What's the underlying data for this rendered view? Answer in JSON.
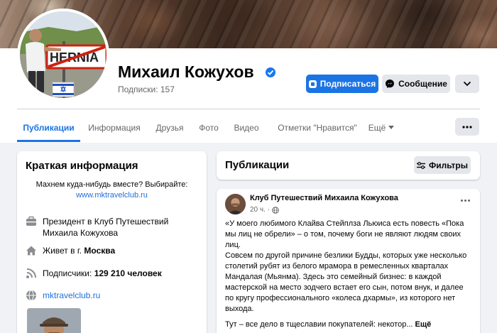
{
  "profile": {
    "name": "Михаил Кожухов",
    "subscribers_label": "Подписки: 157"
  },
  "actions": {
    "subscribe_label": "Подписаться",
    "message_label": "Сообщение"
  },
  "tabs": [
    {
      "label": "Публикации",
      "active": true
    },
    {
      "label": "Информация"
    },
    {
      "label": "Друзья"
    },
    {
      "label": "Фото"
    },
    {
      "label": "Видео"
    },
    {
      "label": "Отметки \"Нравится\""
    },
    {
      "label": "Ещё"
    }
  ],
  "intro": {
    "title": "Краткая информация",
    "bio": "Махнем куда-нибудь вместе? Выбирайте:",
    "bio_link": "www.mktravelclub.ru",
    "work": "Президент в Клуб Путешествий Михаила Кожухова",
    "lives_prefix": "Живет в г. ",
    "lives_city": "Москва",
    "followers_prefix": "Подписчики: ",
    "followers_count": "129 210 человек",
    "website": "mktravelclub.ru"
  },
  "feed": {
    "title": "Публикации",
    "filters_label": "Фильтры"
  },
  "post": {
    "author": "Клуб Путешествий Михаила Кожухова",
    "time": "20 ч.",
    "paragraph_1": "«У моего любимого Клайва Стейплза Льюиса есть повесть «Пока мы лиц не обрели» – о том, почему боги не являют людям своих лиц.",
    "paragraph_2": "Совсем по другой причине безлики Будды, которых уже несколько столетий рубят из белого мрамора в ремесленных кварталах Мандалая (Мьянма). Здесь это семейный бизнес: в каждой мастерской на место зодчего встает его сын, потом внук, и далее по кругу профессионального «колеса дхармы», из которого нет выхода.",
    "paragraph_3": "Тут – все дело в тщеславии покупателей: некотор...",
    "see_more": "Ещё"
  },
  "avatar_sign": "HERNIA",
  "colors": {
    "accent": "#1b74e4",
    "background": "#f0f2f5",
    "muted_text": "#65676b"
  }
}
